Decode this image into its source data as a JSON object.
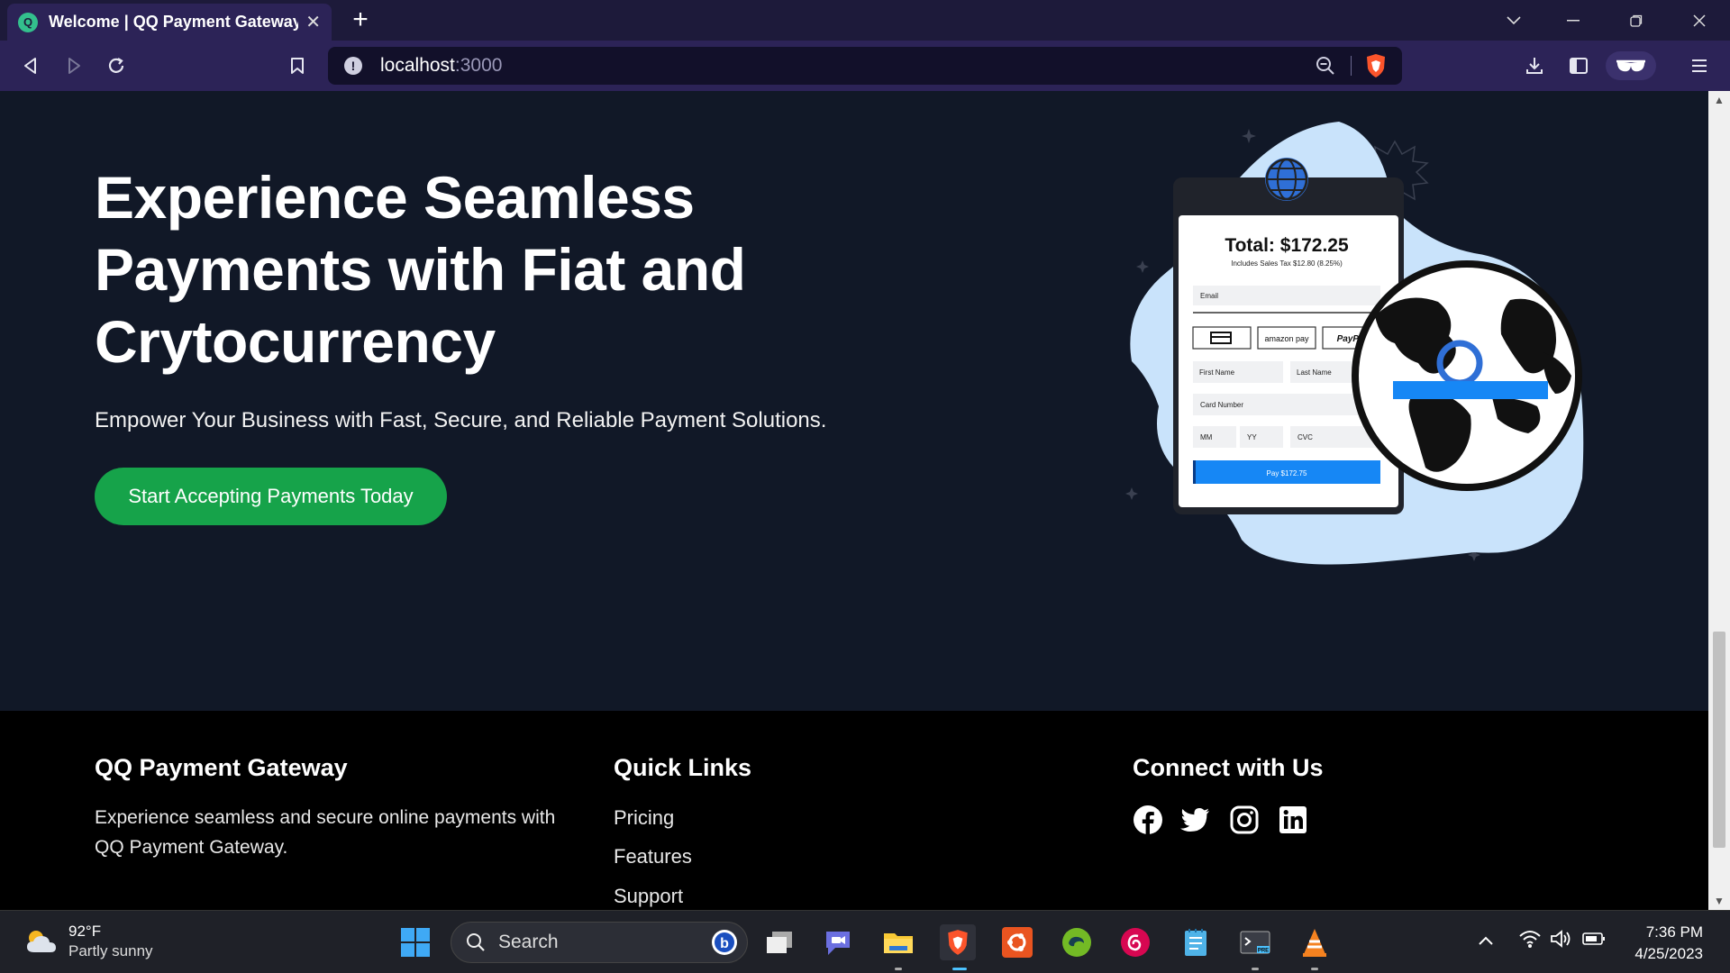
{
  "browser": {
    "tab_title": "Welcome | QQ Payment Gateway",
    "url_host": "localhost",
    "url_port": ":3000"
  },
  "hero": {
    "heading": "Experience Seamless Payments with Fiat and Crytocurrency",
    "subheading": "Empower Your Business with Fast, Secure, and Reliable Payment Solutions.",
    "cta_label": "Start Accepting Payments Today"
  },
  "illustration": {
    "total": "Total: $172.25",
    "tax_note": "Includes Sales Tax $12.80 (8.25%)",
    "email": "Email",
    "amazon": "amazon pay",
    "paypal": "PayPal",
    "first_name": "First Name",
    "last_name": "Last Name",
    "card_number": "Card Number",
    "mm": "MM",
    "yy": "YY",
    "cvc": "CVC",
    "pay_button": "Pay $172.75"
  },
  "footer": {
    "brand_title": "QQ Payment Gateway",
    "brand_desc_1": "Experience seamless and secure online payments with",
    "brand_desc_2": "QQ Payment Gateway.",
    "links_title": "Quick Links",
    "links": [
      "Pricing",
      "Features",
      "Support"
    ],
    "connect_title": "Connect with Us",
    "social": [
      "facebook-icon",
      "twitter-icon",
      "instagram-icon",
      "linkedin-icon"
    ]
  },
  "taskbar": {
    "temperature": "92°F",
    "weather": "Partly sunny",
    "search_placeholder": "Search",
    "time": "7:36 PM",
    "date": "4/25/2023"
  },
  "colors": {
    "page_bg": "#111827",
    "cta": "#16a34a",
    "browser_frame": "#2c2357",
    "pay_button": "#1687f5",
    "blob": "#c9e3fb"
  }
}
